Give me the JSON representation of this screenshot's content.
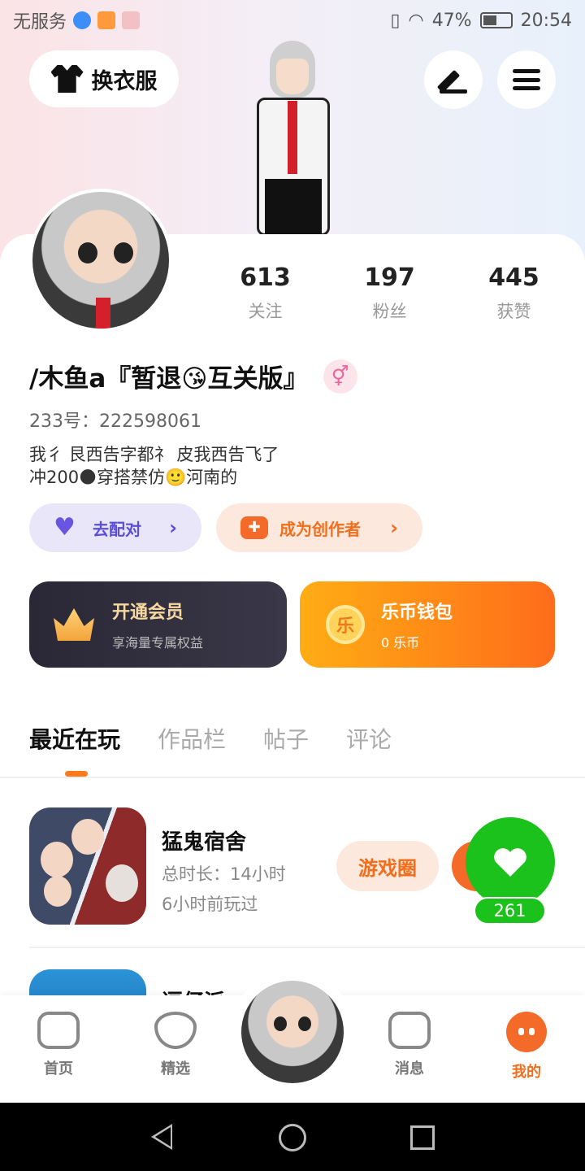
{
  "status_bar": {
    "carrier": "无服务",
    "battery": "47%",
    "time": "20:54"
  },
  "header": {
    "outfit_label": "换衣服",
    "edit_icon": "pen-icon",
    "menu_icon": "hamburger-icon"
  },
  "profile": {
    "stats": [
      {
        "value": "613",
        "label": "关注"
      },
      {
        "value": "197",
        "label": "粉丝"
      },
      {
        "value": "445",
        "label": "获赞"
      }
    ],
    "username": "/木鱼a『暂退😘互关版』",
    "gender_symbol": "⚥",
    "uid": "233号：222598061",
    "bio_line1": "我彳 艮西告字都礻 皮我西告飞了",
    "bio_line2": "冲200🌑穿搭禁仿🙂河南的"
  },
  "actions": {
    "match_label": "去配对",
    "creator_label": "成为创作者"
  },
  "vip": {
    "title": "开通会员",
    "subtitle": "享海量专属权益"
  },
  "wallet": {
    "title": "乐币钱包",
    "subtitle": "0 乐币",
    "coin_glyph": "乐"
  },
  "tabs": [
    "最近在玩",
    "作品栏",
    "帖子",
    "评论"
  ],
  "games": [
    {
      "title": "猛鬼宿舍",
      "duration": "总时长：14小时",
      "last_played": "6小时前玩过",
      "circle_label": "游戏圈"
    },
    {
      "title": "逗仔派"
    }
  ],
  "like_widget": {
    "count": "261"
  },
  "bottom_nav": {
    "items": [
      "首页",
      "精选",
      "消息",
      "我的"
    ],
    "active": "我的"
  },
  "colors": {
    "accent": "#f06e1c",
    "like_green": "#1bc21b",
    "match_purple": "#5a4fd6"
  }
}
